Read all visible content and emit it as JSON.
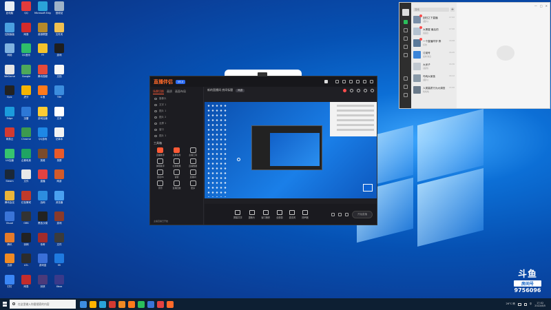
{
  "desktop": {
    "icons": [
      {
        "label": "此电脑",
        "color": "#e9eef5"
      },
      {
        "label": "QQ",
        "color": "#e33b3b"
      },
      {
        "label": "Microsoft Edge",
        "color": "#2aa3d9"
      },
      {
        "label": "回收站",
        "color": "#9fb3c8"
      },
      {
        "label": "控制面板",
        "color": "#4aa0e0"
      },
      {
        "label": "网易",
        "color": "#d22b2b"
      },
      {
        "label": "英雄联盟",
        "color": "#b5892a"
      },
      {
        "label": "文件夹",
        "color": "#f0c050"
      },
      {
        "label": "网络",
        "color": "#7fb2e0"
      },
      {
        "label": "QQ音乐",
        "color": "#2fbd6a"
      },
      {
        "label": "YY",
        "color": "#f3c22c"
      },
      {
        "label": "游戏",
        "color": "#1e1e1e"
      },
      {
        "label": "WeGame",
        "color": "#e5e5e5"
      },
      {
        "label": "Google",
        "color": "#4da85a"
      },
      {
        "label": "腾讯视频",
        "color": "#e64a3a"
      },
      {
        "label": "文档",
        "color": "#f7f7f7"
      },
      {
        "label": "Epic",
        "color": "#222222"
      },
      {
        "label": "虎牙",
        "color": "#f5b400"
      },
      {
        "label": "斗鱼",
        "color": "#ff7a1c"
      },
      {
        "label": "TIM",
        "color": "#3c8dde"
      },
      {
        "label": "Edge",
        "color": "#1b9bdc"
      },
      {
        "label": "迅雷",
        "color": "#2d78d6"
      },
      {
        "label": "游戏加速",
        "color": "#ffcc33"
      },
      {
        "label": "文本",
        "color": "#ffffff"
      },
      {
        "label": "网易云",
        "color": "#d33a31"
      },
      {
        "label": "Chrome",
        "color": "#3c9a4f"
      },
      {
        "label": "QQ游戏",
        "color": "#1e88e5"
      },
      {
        "label": "记事本",
        "color": "#f2f2f2"
      },
      {
        "label": "UU加速",
        "color": "#36c46e"
      },
      {
        "label": "企鹅电竞",
        "color": "#1fa463"
      },
      {
        "label": "英雄",
        "color": "#7a4b2b"
      },
      {
        "label": "录屏",
        "color": "#e85a2a"
      },
      {
        "label": "Steam",
        "color": "#1b2838"
      },
      {
        "label": "文件",
        "color": "#e8e8e8"
      },
      {
        "label": "直播",
        "color": "#e34242"
      },
      {
        "label": "网游",
        "color": "#d25a2a"
      },
      {
        "label": "腾讯会议",
        "color": "#e9b43a"
      },
      {
        "label": "红色警戒",
        "color": "#c03a2a"
      },
      {
        "label": "战网",
        "color": "#2c8de0"
      },
      {
        "label": "浏览器",
        "color": "#4aa0f0"
      },
      {
        "label": "Visual",
        "color": "#3a74d8"
      },
      {
        "label": "OBS",
        "color": "#333333"
      },
      {
        "label": "黑色沙漠",
        "color": "#222222"
      },
      {
        "label": "游戏",
        "color": "#8a3a2a"
      },
      {
        "label": "腾讯",
        "color": "#e47a2a"
      },
      {
        "label": "剑网",
        "color": "#222222"
      },
      {
        "label": "传奇",
        "color": "#a02b2b"
      },
      {
        "label": "文件",
        "color": "#3b3b3b"
      },
      {
        "label": "迅游",
        "color": "#f08a24"
      },
      {
        "label": "LOL",
        "color": "#2c2c2c"
      },
      {
        "label": "游戏盒",
        "color": "#3a6fd8"
      },
      {
        "label": "Mi",
        "color": "#1f7ae0"
      },
      {
        "label": "钉钉",
        "color": "#3b86f5"
      },
      {
        "label": "网易",
        "color": "#c22c2c"
      },
      {
        "label": "剑侠",
        "color": "#4a3a7a"
      },
      {
        "label": "Xbox",
        "color": "#3a3a8a"
      }
    ]
  },
  "streaming_app": {
    "logo": "直播伴侣",
    "version_badge": "V6.0",
    "tabs": [
      "场景切换",
      "画质",
      "画面布局"
    ],
    "scenes": [
      "摄像头",
      "文字 1",
      "图片 1",
      "图片 2",
      "全屏 1",
      "窗口",
      "图片 1"
    ],
    "tools_title": "工具箱",
    "tools": [
      {
        "label": "直播助手",
        "hot": true
      },
      {
        "label": "主播任务",
        "hot": true
      },
      {
        "label": "主播工具",
        "hot": false
      },
      {
        "label": "弹幕助手",
        "hot": false
      },
      {
        "label": "礼物效果",
        "hot": false
      },
      {
        "label": "直播数据",
        "hot": false
      },
      {
        "label": "连麦PK",
        "hot": false
      },
      {
        "label": "语音",
        "hot": false
      },
      {
        "label": "直播间",
        "hot": false
      },
      {
        "label": "音乐",
        "hot": false
      },
      {
        "label": "直播回放",
        "hot": false
      },
      {
        "label": "更多",
        "hot": false
      }
    ],
    "bottom_left_text": "主播直播已开始",
    "room_title": "新的直播间 房间标题",
    "room_tag": "网游",
    "stage_bar": [
      "屏幕共享",
      "摄像头",
      "窗口捕获",
      "全部源",
      "麦克风",
      "扬声器"
    ],
    "go_live": "开始直播"
  },
  "chat_app": {
    "search_placeholder": "搜索",
    "add": "+",
    "window_controls": [
      "—",
      "□",
      "✕"
    ],
    "conversations": [
      {
        "name": "回归之下直播",
        "msg": "[图片]",
        "time": "17:02",
        "color": "#7a8fa8",
        "unread": true
      },
      {
        "name": "大黑屋 最后的",
        "msg": "[链接]",
        "time": "17:00",
        "color": "#b4c2d0",
        "unread": true
      },
      {
        "name": "一个直播同学 群",
        "msg": "好的",
        "time": "16:58",
        "color": "#5b7a9a",
        "unread": true
      },
      {
        "name": "订阅号",
        "msg": "最新消息",
        "time": "16:45",
        "color": "#3a84d8",
        "unread": false
      },
      {
        "name": "大米子",
        "msg": "[语音]",
        "time": "16:30",
        "color": "#c0c8d0",
        "unread": false
      },
      {
        "name": "鸟鸣大家族",
        "msg": "[图片]",
        "time": "16:12",
        "color": "#8a9aa8",
        "unread": false
      },
      {
        "name": "人类高质行为大调查",
        "msg": "哈哈哈",
        "time": "15:50",
        "color": "#6a7a8a",
        "unread": false
      }
    ]
  },
  "watermark": {
    "mark": "斗鱼",
    "room_label": "房间号",
    "room_number": "9756096"
  },
  "taskbar": {
    "search_placeholder": "在这里输入你要搜索的内容",
    "pinned": [
      "#3d8ee0",
      "#ffb400",
      "#2aa3d9",
      "#d33a31",
      "#f08a24",
      "#ff7a1c",
      "#2bbf5b",
      "#3a74d8",
      "#e34242",
      "#ff6a2a"
    ],
    "weather": "26°C 晴",
    "lang": "中",
    "time": "17:02",
    "date": "2022/8/5"
  }
}
